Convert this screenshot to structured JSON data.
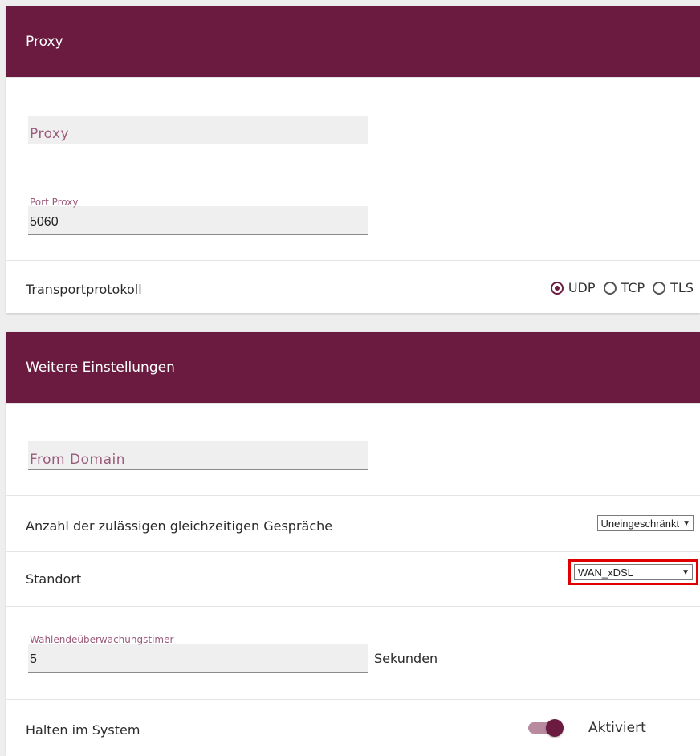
{
  "proxy_section": {
    "title": "Proxy",
    "proxy_field": {
      "placeholder": "Proxy",
      "value": ""
    },
    "port_field": {
      "label": "Port Proxy",
      "value": "5060"
    },
    "transport": {
      "label": "Transportprotokoll",
      "options": [
        "UDP",
        "TCP",
        "TLS"
      ],
      "selected": "UDP"
    }
  },
  "more_section": {
    "title": "Weitere Einstellungen",
    "from_domain": {
      "placeholder": "From Domain",
      "value": ""
    },
    "calls": {
      "label": "Anzahl der zulässigen gleichzeitigen Gespräche",
      "selected": "Uneingeschränkt"
    },
    "location": {
      "label": "Standort",
      "selected": "WAN_xDSL"
    },
    "timer": {
      "label": "Wahlendeüberwachungstimer",
      "value": "5",
      "unit": "Sekunden"
    },
    "hold": {
      "label": "Halten im System",
      "state": "Aktiviert",
      "enabled": true
    }
  },
  "colors": {
    "accent": "#6b1a40",
    "highlight": "#e00000"
  }
}
